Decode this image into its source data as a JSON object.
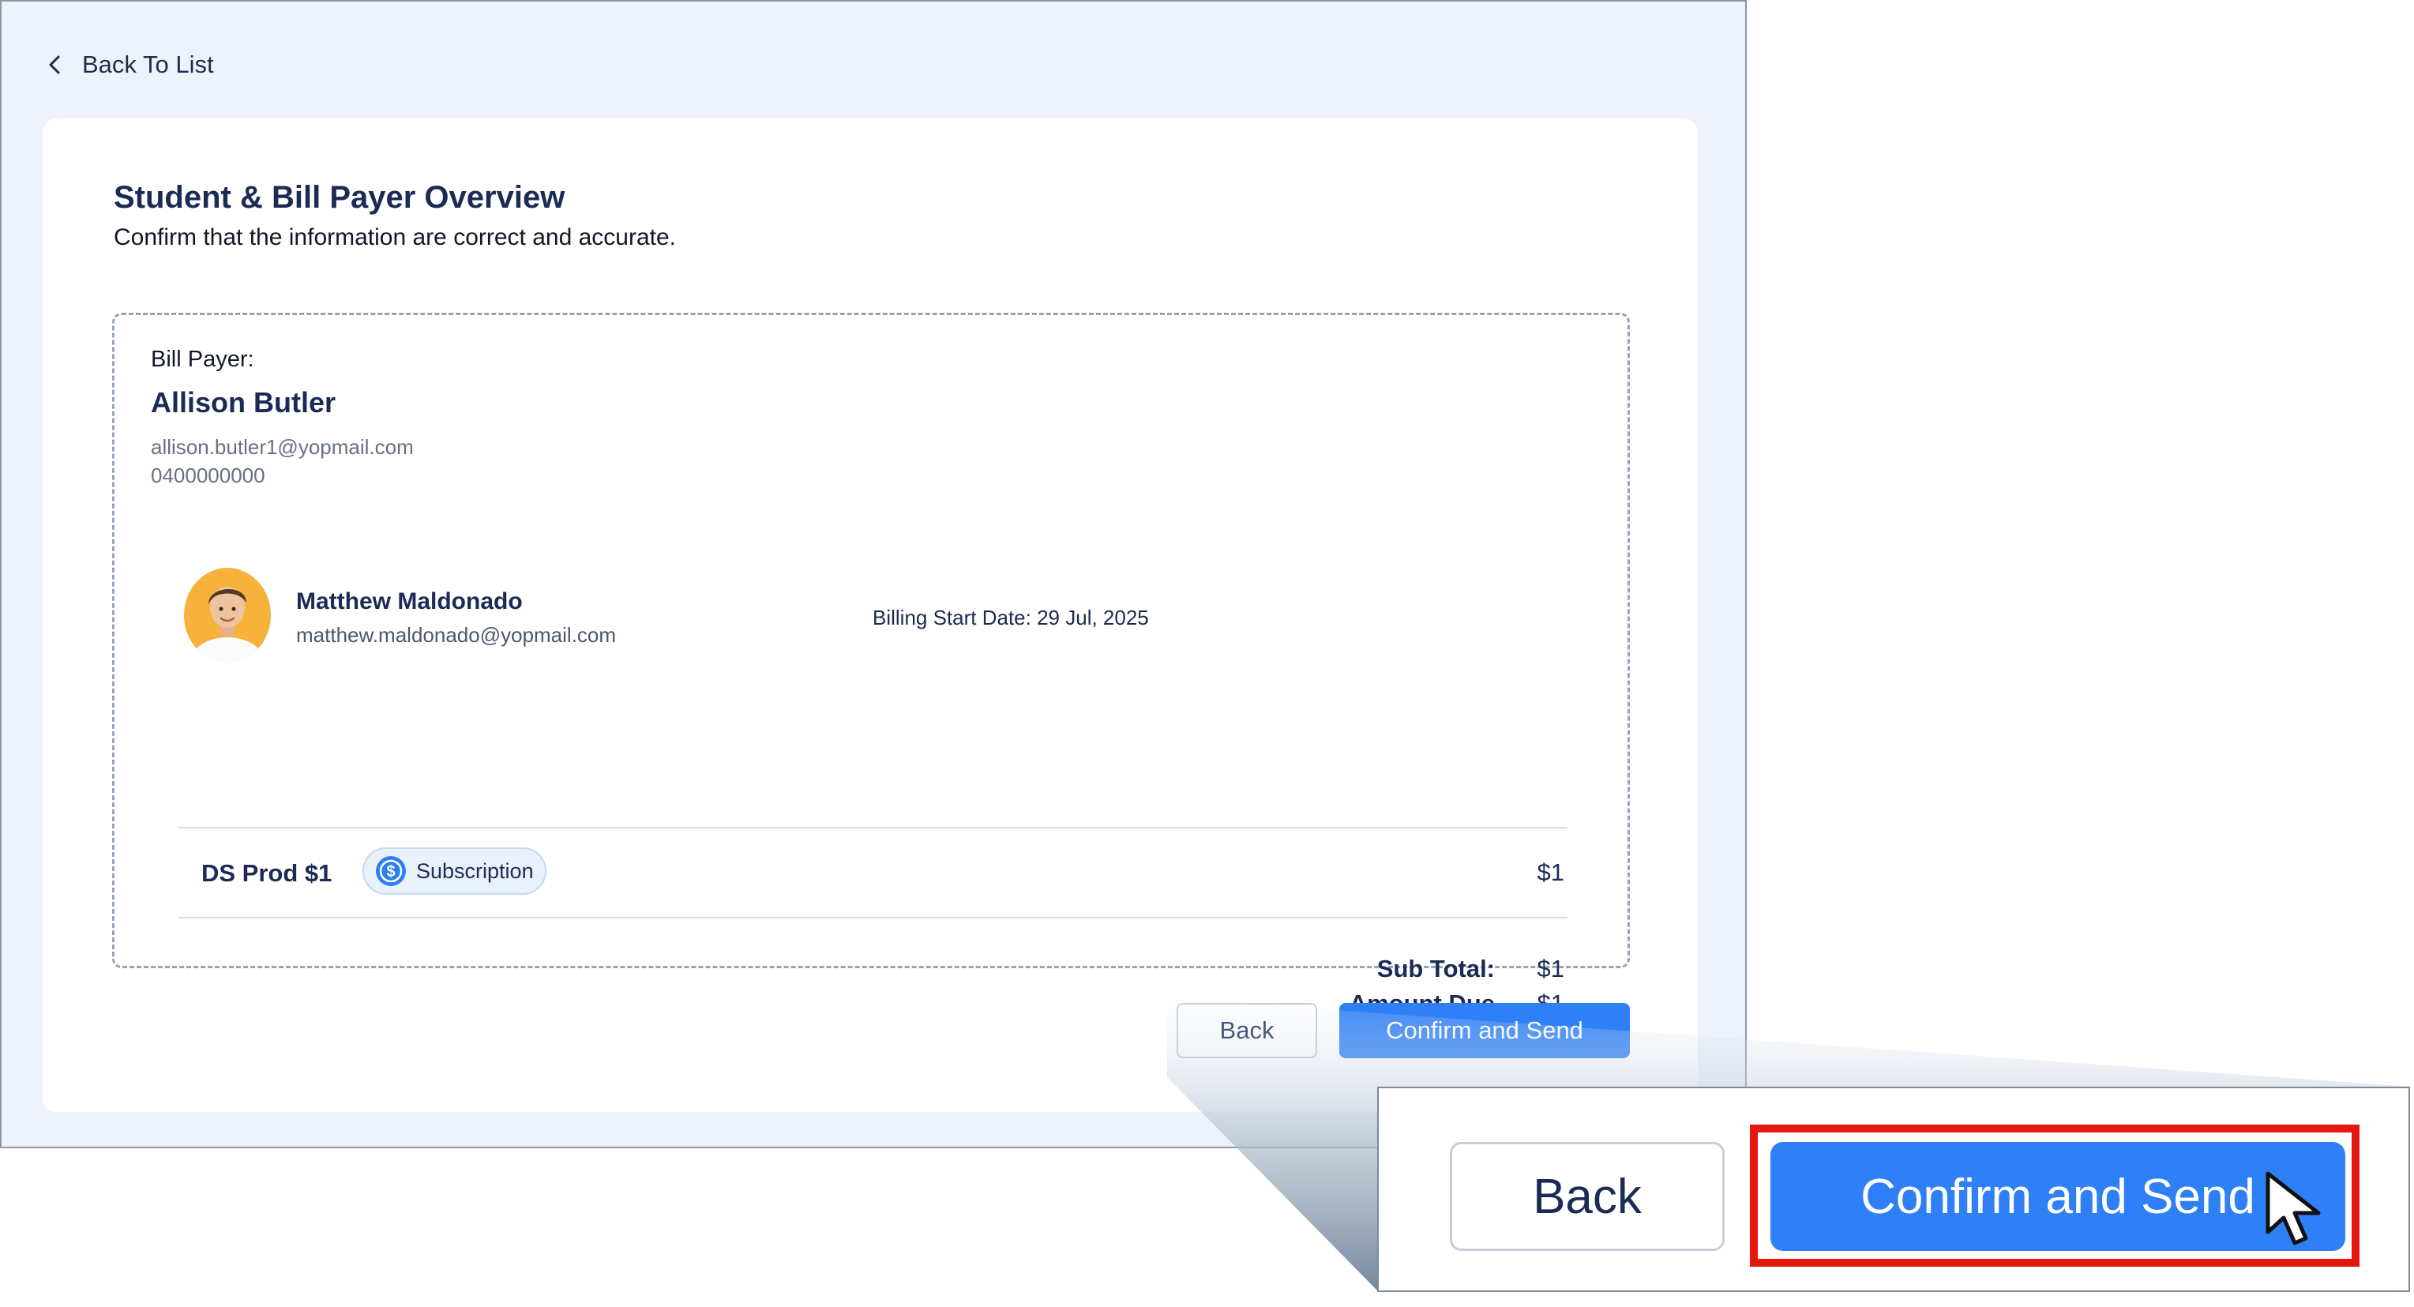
{
  "nav": {
    "back_to_list": "Back To List"
  },
  "overview": {
    "title": "Student & Bill Payer Overview",
    "subtitle": "Confirm that the information are correct and accurate."
  },
  "bill_payer": {
    "label": "Bill Payer:",
    "name": "Allison Butler",
    "email": "allison.butler1@yopmail.com",
    "phone": "0400000000"
  },
  "student": {
    "name": "Matthew Maldonado",
    "email": "matthew.maldonado@yopmail.com",
    "billing_start": "Billing Start Date: 29 Jul, 2025"
  },
  "line_item": {
    "product": "DS Prod $1",
    "badge": "Subscription",
    "badge_icon": "dollar-circle-icon",
    "price": "$1"
  },
  "totals": {
    "subtotal_label": "Sub Total:",
    "subtotal_value": "$1",
    "amount_due_label": "Amount Due",
    "amount_due_value": "$1"
  },
  "actions": {
    "back": "Back",
    "confirm": "Confirm and Send"
  },
  "zoom": {
    "back": "Back",
    "confirm": "Confirm and Send"
  },
  "colors": {
    "primary": "#2f80f6",
    "page_bg": "#eef3fb",
    "heading": "#1b2b55",
    "highlight": "#e6180e"
  }
}
